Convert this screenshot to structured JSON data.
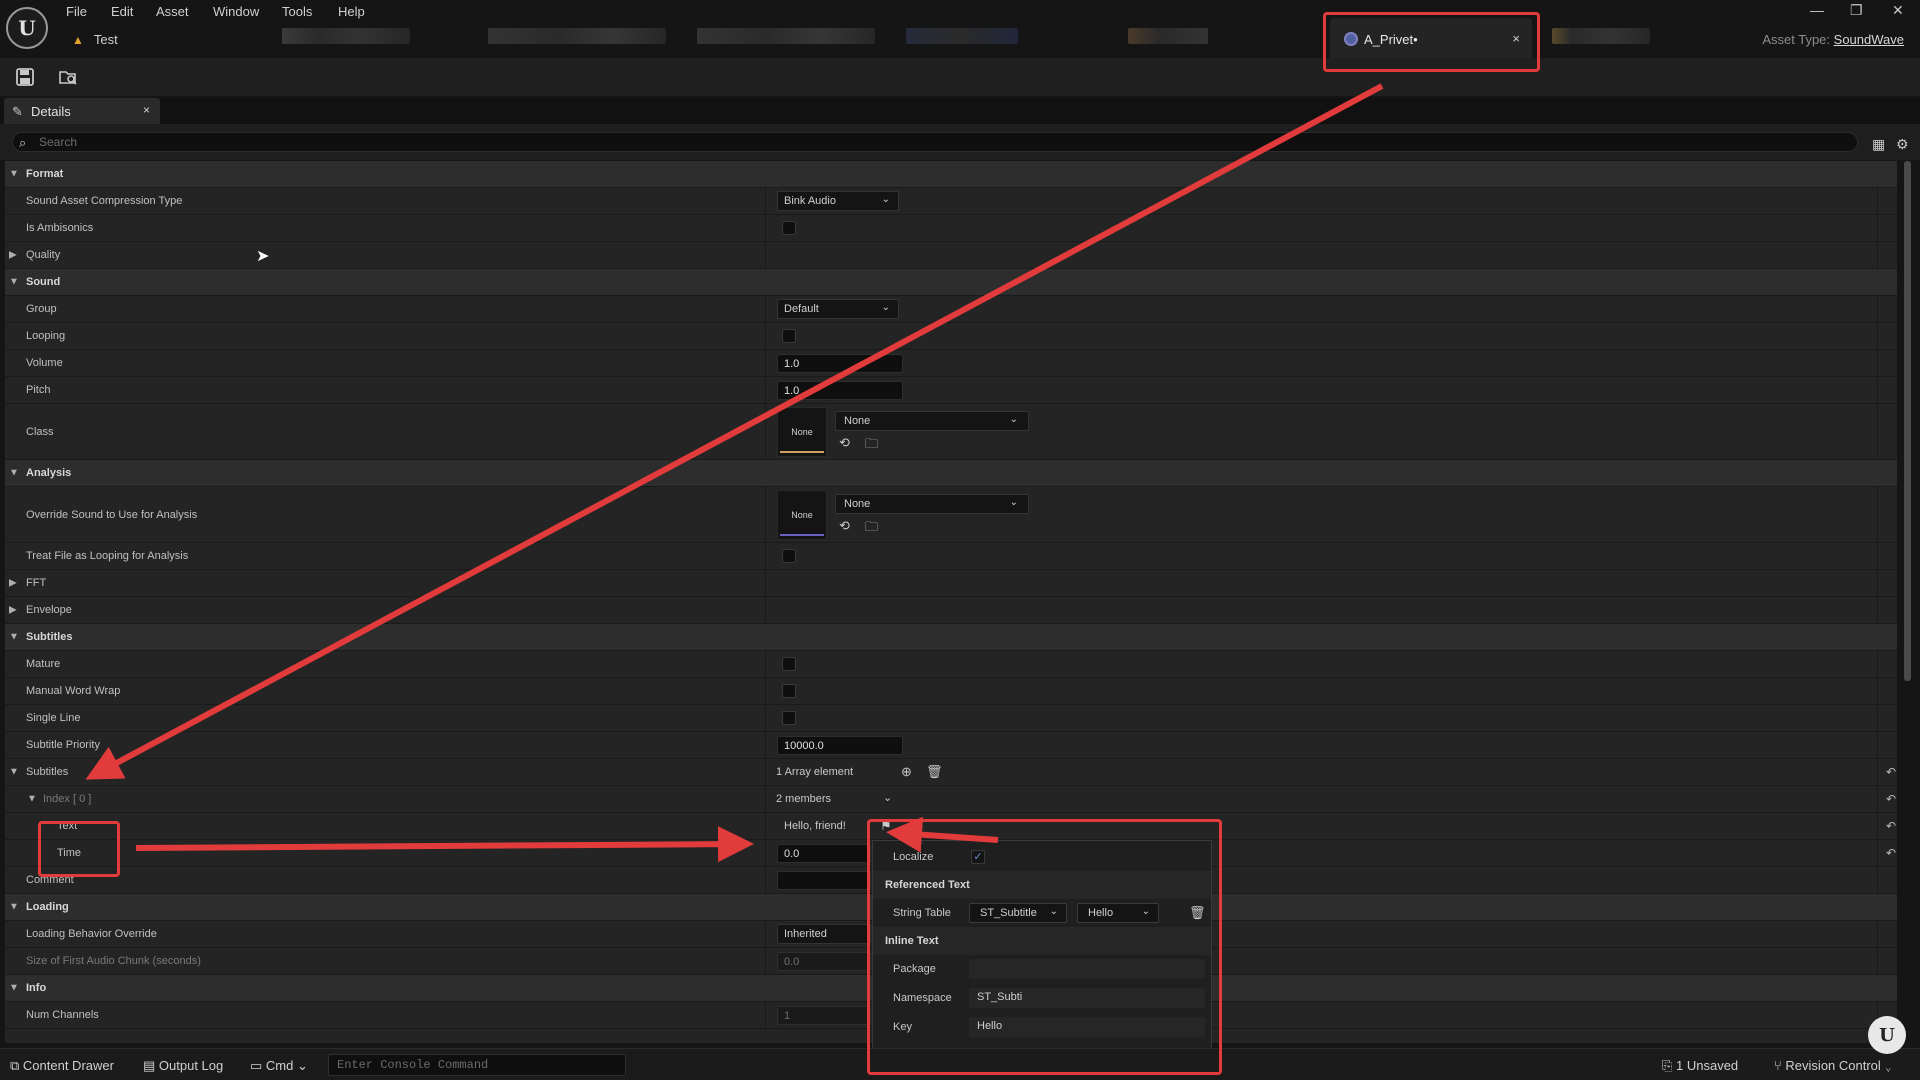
{
  "menu": [
    "File",
    "Edit",
    "Asset",
    "Window",
    "Tools",
    "Help"
  ],
  "project": {
    "name": "Test"
  },
  "active_tab": {
    "title": "A_Privet",
    "modified_marker": "•",
    "close": "×"
  },
  "asset_type": {
    "label": "Asset Type:",
    "value": "SoundWave"
  },
  "window_controls": {
    "minimize": "—",
    "restore": "❐",
    "close": "✕"
  },
  "details_tab": {
    "label": "Details",
    "close": "×"
  },
  "search": {
    "placeholder": "Search"
  },
  "format": {
    "title": "Format",
    "compression": {
      "label": "Sound Asset Compression Type",
      "value": "Bink Audio"
    },
    "ambisonics": {
      "label": "Is Ambisonics"
    },
    "quality": {
      "label": "Quality"
    }
  },
  "sound": {
    "title": "Sound",
    "group": {
      "label": "Group",
      "value": "Default"
    },
    "looping": {
      "label": "Looping"
    },
    "volume": {
      "label": "Volume",
      "value": "1.0"
    },
    "pitch": {
      "label": "Pitch",
      "value": "1.0"
    },
    "class": {
      "label": "Class",
      "thumb": "None",
      "value": "None"
    }
  },
  "analysis": {
    "title": "Analysis",
    "override": {
      "label": "Override Sound to Use for Analysis",
      "thumb": "None",
      "value": "None"
    },
    "treat_looping": {
      "label": "Treat File as Looping for Analysis"
    },
    "fft": {
      "label": "FFT"
    },
    "envelope": {
      "label": "Envelope"
    }
  },
  "subtitles_cat": {
    "title": "Subtitles",
    "mature": {
      "label": "Mature"
    },
    "word_wrap": {
      "label": "Manual Word Wrap"
    },
    "single_line": {
      "label": "Single Line"
    },
    "priority": {
      "label": "Subtitle Priority",
      "value": "10000.0"
    },
    "array": {
      "label": "Subtitles",
      "value": "1 Array element"
    },
    "index": {
      "label": "Index [ 0 ]",
      "value": "2 members"
    },
    "text": {
      "label": "Text",
      "value": "Hello, friend!"
    },
    "time": {
      "label": "Time",
      "value": "0.0"
    },
    "comment": {
      "label": "Comment"
    }
  },
  "loading": {
    "title": "Loading",
    "behavior": {
      "label": "Loading Behavior Override",
      "value": "Inherited"
    },
    "first_chunk": {
      "label": "Size of First Audio Chunk (seconds)",
      "value": "0.0"
    }
  },
  "info": {
    "title": "Info",
    "channels": {
      "label": "Num Channels",
      "value": "1"
    }
  },
  "text_popup": {
    "localize": {
      "label": "Localize",
      "checked": true
    },
    "referenced_text": "Referenced Text",
    "string_table": {
      "label": "String Table",
      "table": "ST_Subtitle",
      "key": "Hello"
    },
    "inline_text": "Inline Text",
    "package": {
      "label": "Package",
      "value": ""
    },
    "namespace": {
      "label": "Namespace",
      "value": "ST_Subti"
    },
    "key": {
      "label": "Key",
      "value": "Hello"
    }
  },
  "statusbar": {
    "content_drawer": "Content Drawer",
    "output_log": "Output Log",
    "cmd": "Cmd",
    "console_placeholder": "Enter Console Command",
    "unsaved": "1 Unsaved",
    "revision_control": "Revision Control"
  },
  "colors": {
    "annotation": "#e23b3b",
    "class_accent": "#d0a060",
    "analysis_accent": "#6a60c0"
  }
}
